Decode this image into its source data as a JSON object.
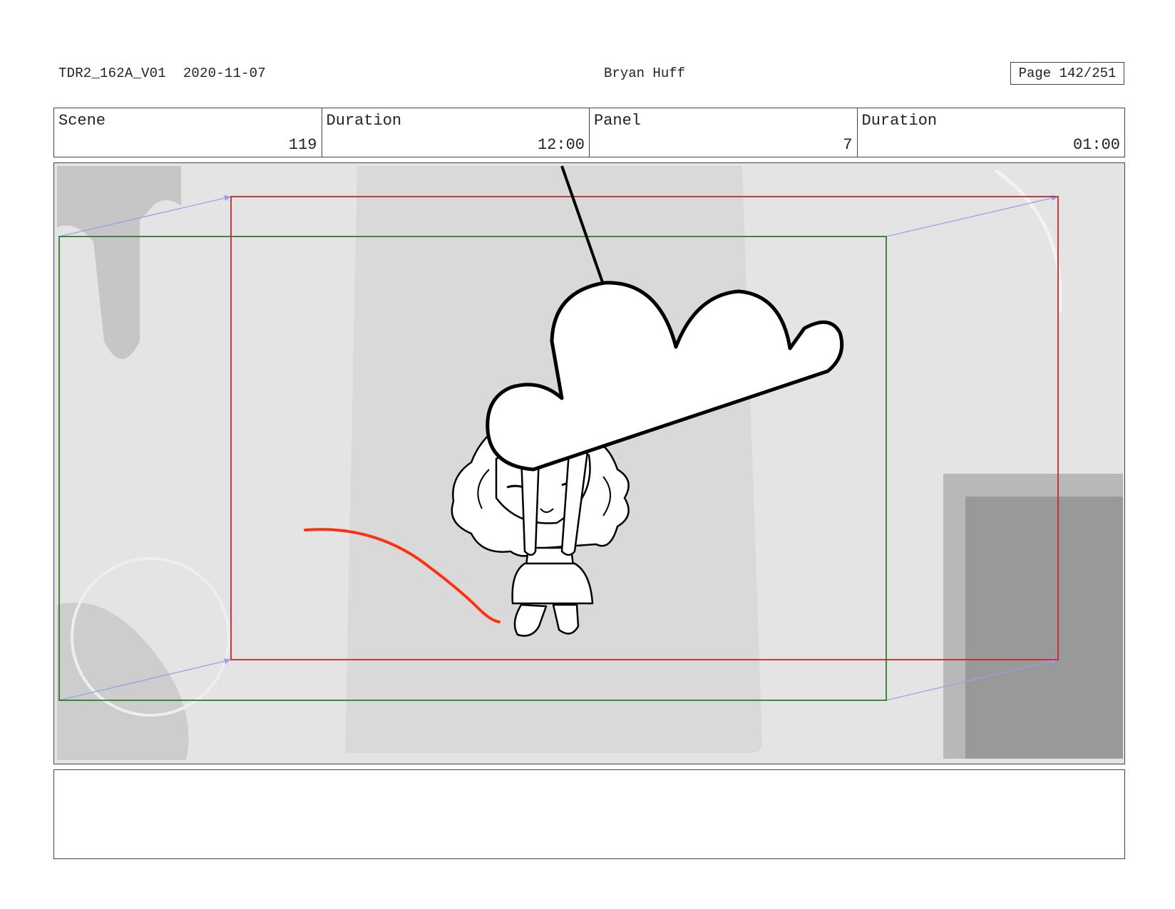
{
  "header": {
    "production_code": "TDR2_162A_V01",
    "date": "2020-11-07",
    "artist": "Bryan Huff",
    "page_label": "Page 142/251"
  },
  "info_table": {
    "scene_label": "Scene",
    "scene_value": "119",
    "scene_duration_label": "Duration",
    "scene_duration_value": "12:00",
    "panel_label": "Panel",
    "panel_value": "7",
    "panel_duration_label": "Duration",
    "panel_duration_value": "01:00"
  },
  "panel": {
    "colors": {
      "background": "#e4e4e4",
      "spotlight": "#d8d8d8",
      "start_frame": "#2e7d2e",
      "end_frame": "#c62828",
      "camera_path": "#9aa0e8",
      "motion_line": "#ff3010"
    }
  },
  "notes": {
    "text": ""
  }
}
